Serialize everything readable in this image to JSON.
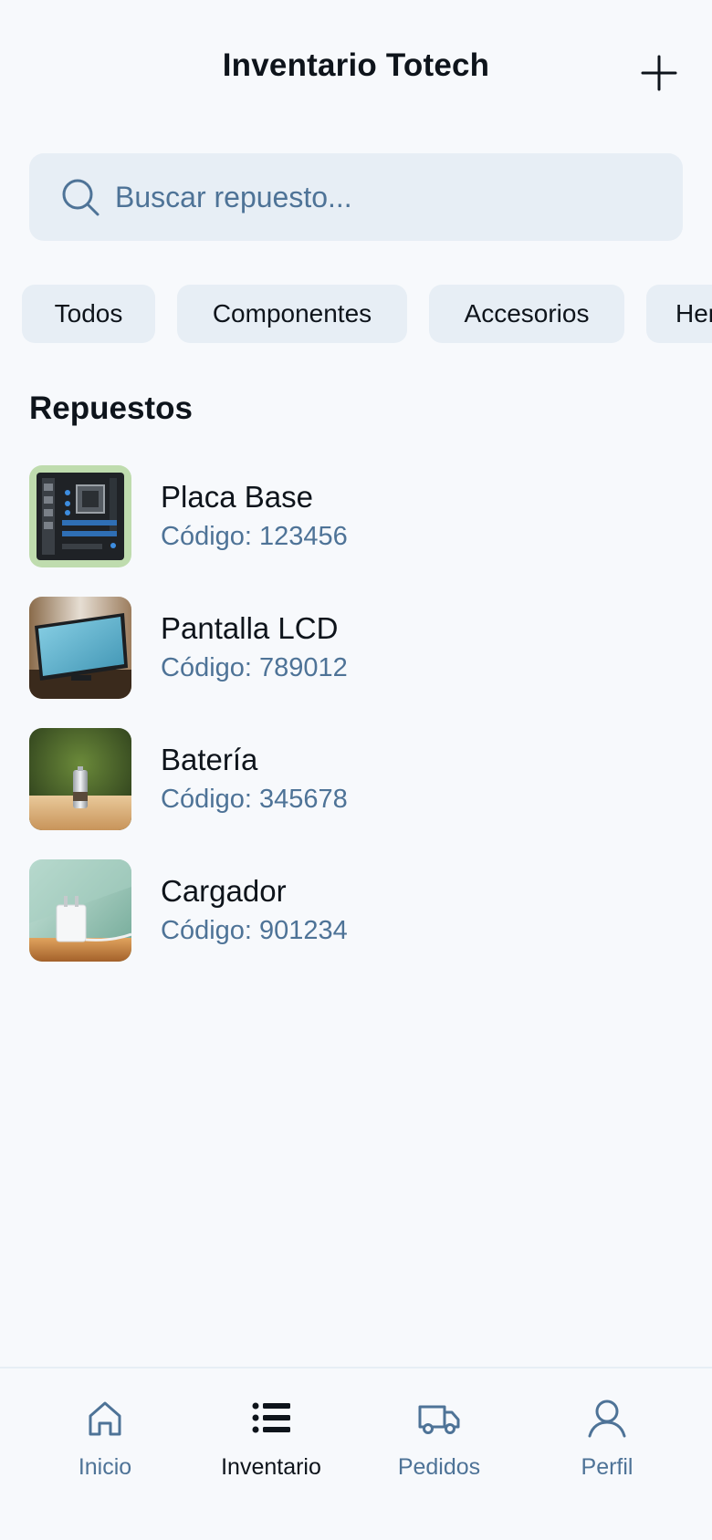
{
  "header": {
    "title": "Inventario Totech",
    "add_icon": "plus-icon"
  },
  "search": {
    "placeholder": "Buscar repuesto...",
    "value": "",
    "icon": "search-icon"
  },
  "filters": [
    {
      "label": "Todos"
    },
    {
      "label": "Componentes"
    },
    {
      "label": "Accesorios"
    },
    {
      "label": "Her"
    }
  ],
  "section": {
    "title": "Repuestos"
  },
  "items": [
    {
      "name": "Placa Base",
      "code": "Código: 123456",
      "thumbnail": "motherboard-image"
    },
    {
      "name": "Pantalla LCD",
      "code": "Código: 789012",
      "thumbnail": "lcd-screen-image"
    },
    {
      "name": "Batería",
      "code": "Código: 345678",
      "thumbnail": "battery-image"
    },
    {
      "name": "Cargador",
      "code": "Código: 901234",
      "thumbnail": "charger-image"
    }
  ],
  "nav": [
    {
      "label": "Inicio",
      "icon": "home-icon",
      "active": false
    },
    {
      "label": "Inventario",
      "icon": "list-icon",
      "active": true
    },
    {
      "label": "Pedidos",
      "icon": "truck-icon",
      "active": false
    },
    {
      "label": "Perfil",
      "icon": "user-icon",
      "active": false
    }
  ],
  "colors": {
    "background": "#f7f9fc",
    "surface": "#e7eef5",
    "text_primary": "#0e141b",
    "text_secondary": "#4e7397"
  }
}
